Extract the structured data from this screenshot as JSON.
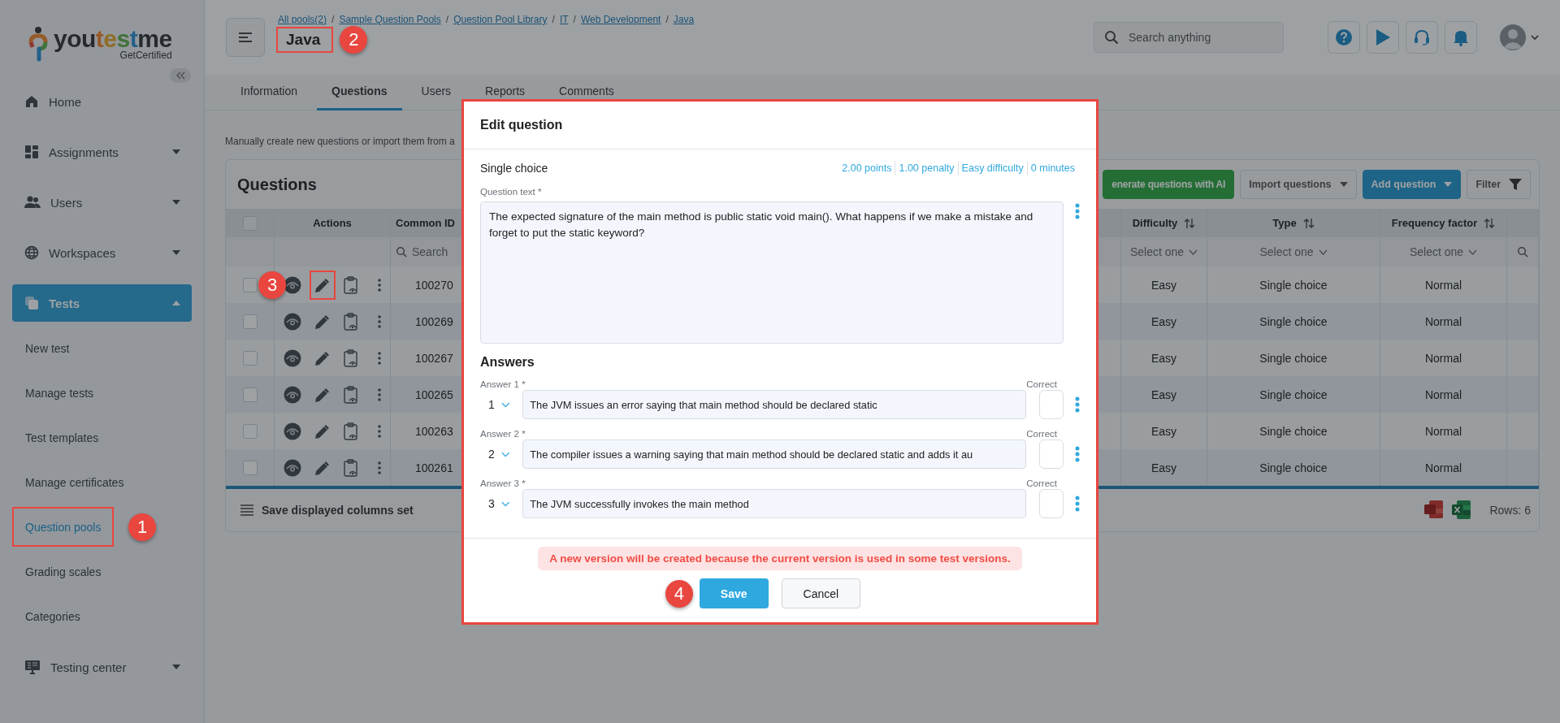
{
  "sidebar": {
    "logo": {
      "name": "youtestme",
      "tagline": "GetCertified"
    },
    "items": [
      {
        "label": "Home",
        "kind": "link",
        "selected": false
      },
      {
        "label": "Assignments",
        "kind": "group",
        "expanded": false,
        "selected": false
      },
      {
        "label": "Users",
        "kind": "group",
        "expanded": false,
        "selected": false
      },
      {
        "label": "Workspaces",
        "kind": "group",
        "expanded": false,
        "selected": false
      },
      {
        "label": "Tests",
        "kind": "group",
        "expanded": true,
        "selected": true,
        "children": [
          {
            "label": "New test",
            "selected": false,
            "highlighted": false
          },
          {
            "label": "Manage tests",
            "selected": false,
            "highlighted": false
          },
          {
            "label": "Test templates",
            "selected": false,
            "highlighted": false
          },
          {
            "label": "Manage certificates",
            "selected": false,
            "highlighted": false
          },
          {
            "label": "Question pools",
            "selected": true,
            "highlighted": true,
            "callout": "1"
          },
          {
            "label": "Grading scales",
            "selected": false,
            "highlighted": false
          },
          {
            "label": "Categories",
            "selected": false,
            "highlighted": false
          }
        ]
      },
      {
        "label": "Testing center",
        "kind": "group",
        "expanded": false,
        "selected": false
      }
    ]
  },
  "header": {
    "breadcrumbs": [
      {
        "label": "All pools(2)"
      },
      {
        "separator": "/",
        "label": "Sample Question Pools"
      },
      {
        "separator": "/",
        "label": "Question Pool Library"
      },
      {
        "separator": "/",
        "label": "IT"
      },
      {
        "separator": "/",
        "label": "Web Development"
      },
      {
        "separator": "/",
        "label": "Java"
      }
    ],
    "title": {
      "text": "Java",
      "highlighted": true,
      "callout": "2"
    },
    "search": {
      "placeholder": "Search anything"
    }
  },
  "tabs": [
    {
      "label": "Information",
      "selected": false
    },
    {
      "label": "Questions",
      "selected": true
    },
    {
      "label": "Users",
      "selected": false
    },
    {
      "label": "Reports",
      "selected": false
    },
    {
      "label": "Comments",
      "selected": false
    }
  ],
  "description": "Manually create new questions or import them from a",
  "questions": {
    "title": "Questions",
    "actions": [
      {
        "label": "enerate questions with AI",
        "kind": "ai"
      },
      {
        "label": "Import questions",
        "kind": "dropdown"
      },
      {
        "label": "Add question",
        "kind": "primary"
      },
      {
        "label": "Filter",
        "kind": "filter"
      }
    ],
    "columns": [
      {
        "kind": "select",
        "checked": false
      },
      {
        "kind": "actions",
        "label": "Actions"
      },
      {
        "kind": "search",
        "label": "Common ID",
        "filter": "Search"
      },
      {
        "kind": "sort",
        "label": "Difficulty",
        "filter": "Select one"
      },
      {
        "kind": "sort",
        "label": "Type",
        "filter": "Select one"
      },
      {
        "kind": "sort",
        "label": "Frequency factor",
        "filter": "Select one"
      },
      {
        "kind": "search-only"
      }
    ],
    "rows": [
      {
        "selected": false,
        "edit_highlighted": true,
        "callout": "3",
        "common_id": "100270",
        "difficulty": "Easy",
        "type": "Single choice",
        "frequency": "Normal"
      },
      {
        "selected": false,
        "edit_highlighted": false,
        "common_id": "100269",
        "difficulty": "Easy",
        "type": "Single choice",
        "frequency": "Normal"
      },
      {
        "selected": false,
        "edit_highlighted": false,
        "common_id": "100267",
        "difficulty": "Easy",
        "type": "Single choice",
        "frequency": "Normal"
      },
      {
        "selected": false,
        "edit_highlighted": false,
        "common_id": "100265",
        "difficulty": "Easy",
        "type": "Single choice",
        "frequency": "Normal"
      },
      {
        "selected": false,
        "edit_highlighted": false,
        "common_id": "100263",
        "difficulty": "Easy",
        "type": "Single choice",
        "frequency": "Normal"
      },
      {
        "selected": false,
        "edit_highlighted": false,
        "common_id": "100261",
        "difficulty": "Easy",
        "type": "Single choice",
        "frequency": "Normal"
      }
    ],
    "footer": {
      "save_columns": "Save displayed columns set",
      "rows": "Rows: 6"
    }
  },
  "modal": {
    "title": "Edit question",
    "highlighted": true,
    "type": "Single choice",
    "meta": [
      "2.00 points",
      "1.00 penalty",
      "Easy difficulty",
      "0 minutes"
    ],
    "question_label": "Question text *",
    "question_text": "The expected signature of the main method is public static void main(). What happens if we make a mistake and forget to put the static keyword?",
    "answers_heading": "Answers",
    "answers": [
      {
        "label": "Answer 1 *",
        "number": "1",
        "correct_label": "Correct",
        "correct": false,
        "text": "The JVM issues an error saying that main method should be declared static"
      },
      {
        "label": "Answer 2 *",
        "number": "2",
        "correct_label": "Correct",
        "correct": false,
        "text": "The compiler issues a warning saying that main method should be declared static and adds it au"
      },
      {
        "label": "Answer 3 *",
        "number": "3",
        "correct_label": "Correct",
        "correct": false,
        "text": "The JVM successfully invokes the main method"
      }
    ],
    "warning": "A new version will be created because the current version is used in some test versions.",
    "buttons": [
      {
        "label": "Save",
        "kind": "primary",
        "callout": "4"
      },
      {
        "label": "Cancel",
        "kind": "secondary"
      }
    ]
  }
}
